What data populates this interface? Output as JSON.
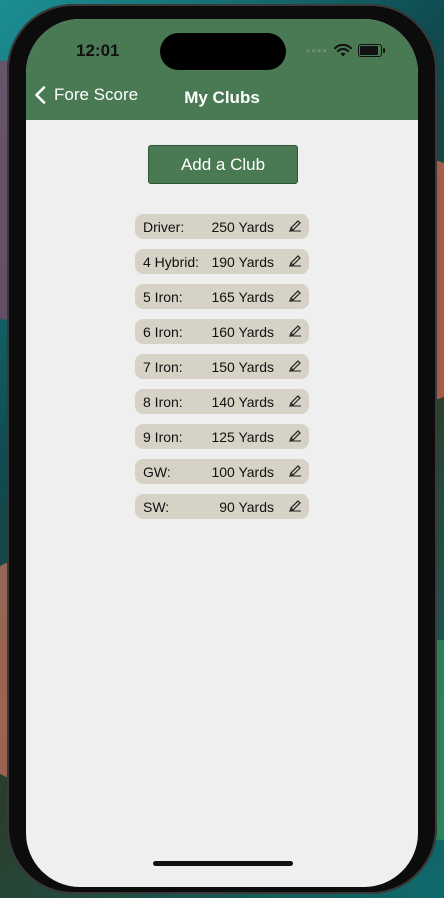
{
  "status_bar": {
    "time": "12:01",
    "signal_dots": "••••"
  },
  "nav": {
    "back_label": "Fore Score",
    "title": "My Clubs"
  },
  "actions": {
    "add_club_label": "Add a Club"
  },
  "clubs": [
    {
      "name": "Driver:",
      "distance": "250 Yards"
    },
    {
      "name": "4 Hybrid:",
      "distance": "190 Yards"
    },
    {
      "name": "5 Iron:",
      "distance": "165 Yards"
    },
    {
      "name": "6 Iron:",
      "distance": "160 Yards"
    },
    {
      "name": "7 Iron:",
      "distance": "150 Yards"
    },
    {
      "name": "8 Iron:",
      "distance": "140 Yards"
    },
    {
      "name": "9 Iron:",
      "distance": "125 Yards"
    },
    {
      "name": "GW:",
      "distance": "100 Yards"
    },
    {
      "name": "SW:",
      "distance": "90 Yards"
    }
  ],
  "icons": {
    "back": "chevron-left-icon",
    "edit": "pencil-icon",
    "wifi": "wifi-icon",
    "battery": "battery-icon"
  },
  "colors": {
    "accent_green": "#4a7a53",
    "row_bg": "#d6d2c5",
    "screen_bg": "#efefef"
  }
}
